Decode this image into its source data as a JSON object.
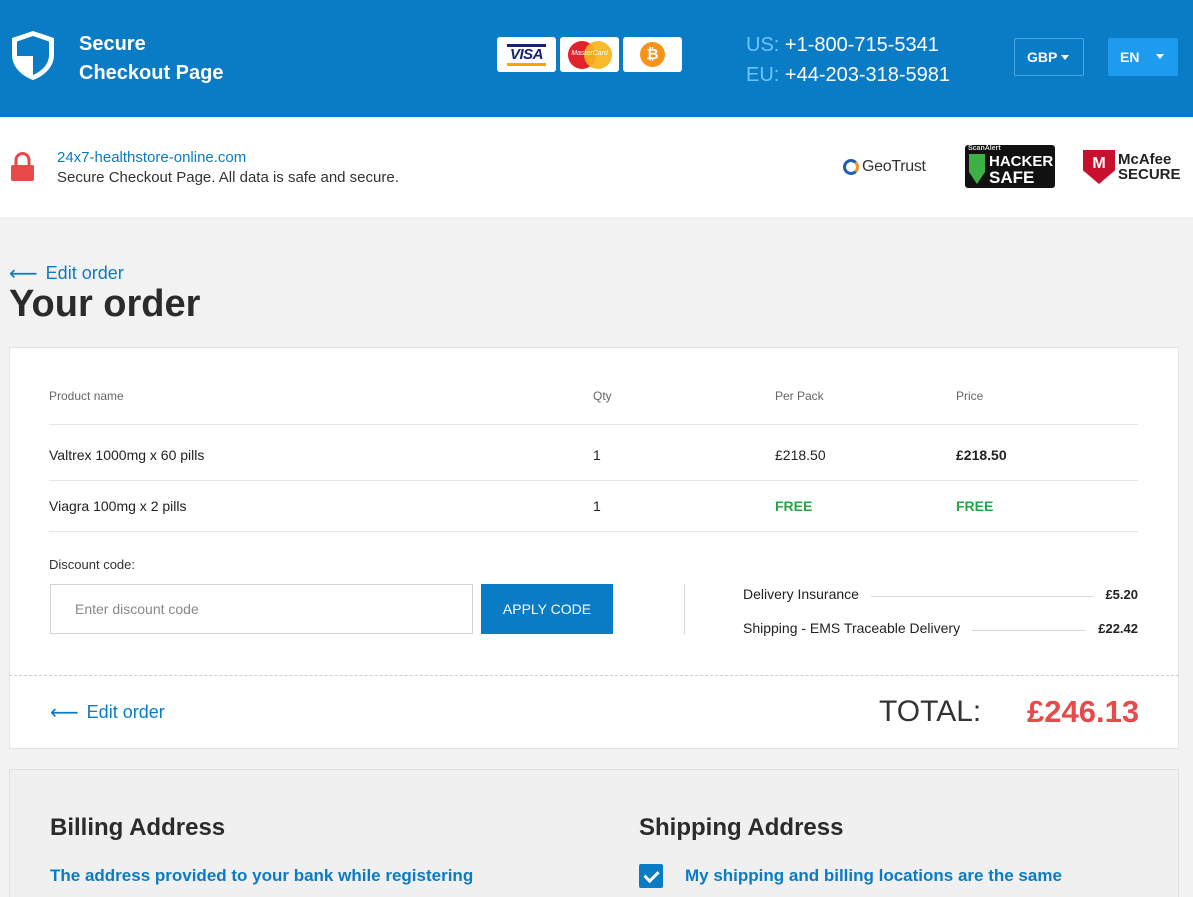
{
  "header": {
    "brand_line1": "Secure",
    "brand_line2": "Checkout Page",
    "payment_cards": [
      "VISA",
      "MasterCard",
      "₿"
    ],
    "phones": [
      {
        "prefix": "US:",
        "number": "+1-800-715-5341"
      },
      {
        "prefix": "EU:",
        "number": "+44-203-318-5981"
      }
    ],
    "currency": "GBP",
    "language": "EN",
    "colors": {
      "primary": "#0a7bc5",
      "accent_blue": "#1d9bee"
    }
  },
  "security": {
    "domain": "24x7-healthstore-online.com",
    "note": "Secure Checkout Page. All data is safe and secure.",
    "badges": {
      "geotrust": "GeoTrust",
      "scanalert": "ScanAlert",
      "hacker": "HACKER",
      "safe": "SAFE",
      "mcafee_line1": "McAfee",
      "mcafee_line2": "SECURE"
    }
  },
  "order": {
    "edit_label": "Edit order",
    "title": "Your order",
    "columns": [
      "Product name",
      "Qty",
      "Per Pack",
      "Price"
    ],
    "items": [
      {
        "name": "Valtrex 1000mg x 60 pills",
        "qty": "1",
        "per_pack": "£218.50",
        "price": "£218.50"
      },
      {
        "name": "Viagra 100mg x 2 pills",
        "qty": "1",
        "per_pack": "FREE",
        "price": "FREE"
      }
    ],
    "discount_label": "Discount code:",
    "discount_placeholder": "Enter discount code",
    "apply_label": "APPLY CODE",
    "fees": [
      {
        "label": "Delivery Insurance",
        "value": "£5.20"
      },
      {
        "label": "Shipping - EMS Traceable Delivery",
        "value": "£22.42"
      }
    ],
    "total_label": "TOTAL:",
    "total_value": "£246.13",
    "total_color": "#e84a4a",
    "free_color": "#27a744"
  },
  "addresses": {
    "billing_title": "Billing Address",
    "billing_sub": "The address provided to your bank while registering",
    "shipping_title": "Shipping Address",
    "same_checked": true,
    "same_label": "My shipping and billing locations are the same"
  }
}
